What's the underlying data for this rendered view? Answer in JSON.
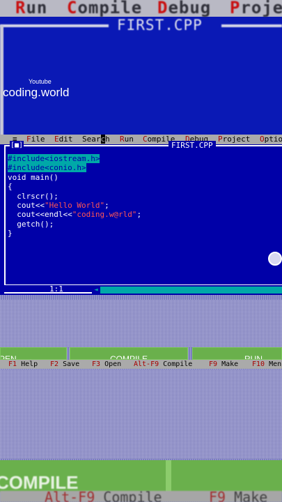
{
  "zoomed_top": {
    "menu": [
      {
        "hot": "R",
        "rest": "un"
      },
      {
        "hot": "C",
        "rest": "ompile"
      },
      {
        "hot": "D",
        "rest": "ebug"
      },
      {
        "hot": "P",
        "rest": "roje"
      }
    ],
    "title": "FIRST.CPP"
  },
  "watermark": {
    "channel": "Youtube",
    "name": "coding.world"
  },
  "menubar": {
    "system": "≡",
    "items": [
      {
        "hot": "F",
        "rest": "ile"
      },
      {
        "hot": "E",
        "rest": "dit"
      },
      {
        "hot": "",
        "rest": "Sear",
        "cursor": "c",
        "tail": "h"
      },
      {
        "hot": "R",
        "rest": "un"
      },
      {
        "hot": "C",
        "rest": "ompile"
      },
      {
        "hot": "D",
        "rest": "ebug"
      },
      {
        "hot": "P",
        "rest": "roject"
      },
      {
        "hot": "O",
        "rest": "ptio"
      }
    ]
  },
  "editor": {
    "close_button": "[■]",
    "title": "FIRST.CPP",
    "code": {
      "l1": "#include<iostream.h>",
      "l2": "#include<conio.h>",
      "l3": "void main()",
      "l4": "{",
      "l5a": "  clrscr();",
      "l6a": "  cout<<",
      "l6b": "\"Hello World\"",
      "l6c": ";",
      "l7a": "  cout<<endl<<",
      "l7b": "\"coding.w@rld\"",
      "l7c": ";",
      "l8": "  getch();",
      "l9": "}"
    },
    "cursor_position": "1:1"
  },
  "overlay_buttons": {
    "open_label": "PEN",
    "compile_label": "COMPILE",
    "run_label": "RUN"
  },
  "function_keys": [
    {
      "key": "F1",
      "label": "Help"
    },
    {
      "key": "F2",
      "label": "Save"
    },
    {
      "key": "F3",
      "label": "Open"
    },
    {
      "key": "Alt-F9",
      "label": "Compile"
    },
    {
      "key": "F9",
      "label": "Make"
    },
    {
      "key": "F10",
      "label": "Men"
    }
  ],
  "zoomed_bottom": {
    "compile_label": "COMPILE",
    "fkeys_text_key1": "Alt-F9",
    "fkeys_text_label1": "Compile",
    "fkeys_text_key2": "F9",
    "fkeys_text_label2": "Make"
  },
  "colors": {
    "ide_background": "#0000a8",
    "menu_gray": "#aaaaaa",
    "hotkey_red": "#a80000",
    "selection_cyan": "#00a8a8",
    "overlay_green": "#6ab04c"
  }
}
